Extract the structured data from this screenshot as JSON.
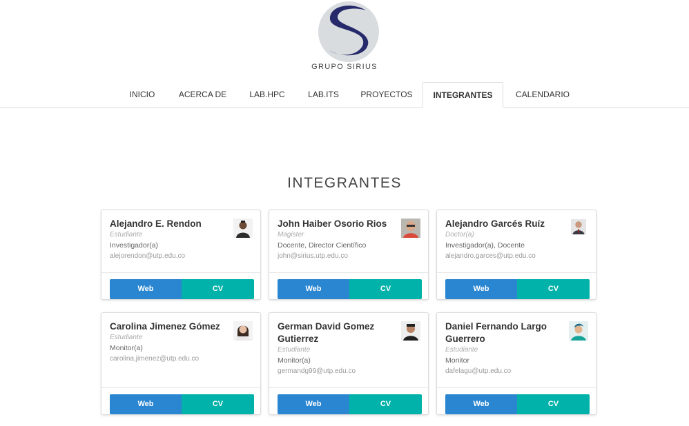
{
  "brand": {
    "name": "GRUPO SIRIUS",
    "logo_bg": "#d9dcdf",
    "logo_accent": "#262a6b"
  },
  "nav": {
    "items": [
      {
        "label": "INICIO"
      },
      {
        "label": "ACERCA DE"
      },
      {
        "label": "LAB.HPC"
      },
      {
        "label": "LAB.ITS"
      },
      {
        "label": "PROYECTOS"
      },
      {
        "label": "INTEGRANTES",
        "active": true
      },
      {
        "label": "CALENDARIO"
      }
    ]
  },
  "section": {
    "title": "INTEGRANTES"
  },
  "members": [
    {
      "name": "Alejandro E. Rendon",
      "degree": "Estudiante",
      "role": "Investigador(a)",
      "email": "alejorendon@utp.edu.co",
      "web": "Web",
      "cv": "CV"
    },
    {
      "name": "John Haiber Osorio Rios",
      "degree": "Magister",
      "role": "Docente, Director Científico",
      "email": "john@sirius.utp.edu.co",
      "web": "Web",
      "cv": "CV"
    },
    {
      "name": "Alejandro Garcés Ruíz",
      "degree": "Doctor(a)",
      "role": "Investigador(a), Docente",
      "email": "alejandro.garces@utp.edu.co",
      "web": "Web",
      "cv": "CV"
    },
    {
      "name": "Carolina Jimenez Gómez",
      "degree": "Estudiante",
      "role": "Monitor(a)",
      "email": "carolina.jimenez@utp.edu.co",
      "web": "Web",
      "cv": "CV"
    },
    {
      "name": "German David Gomez Gutierrez",
      "degree": "Estudiante",
      "role": "Monitor(a)",
      "email": "germandg99@utp.edu.co",
      "web": "Web",
      "cv": "CV"
    },
    {
      "name": "Daniel Fernando Largo Guerrero",
      "degree": "Estudiante",
      "role": "Monitor",
      "email": "dafelagu@utp.edu.co",
      "web": "Web",
      "cv": "CV"
    }
  ],
  "colors": {
    "web_button": "#2a86d0",
    "cv_button": "#00b2a9"
  }
}
